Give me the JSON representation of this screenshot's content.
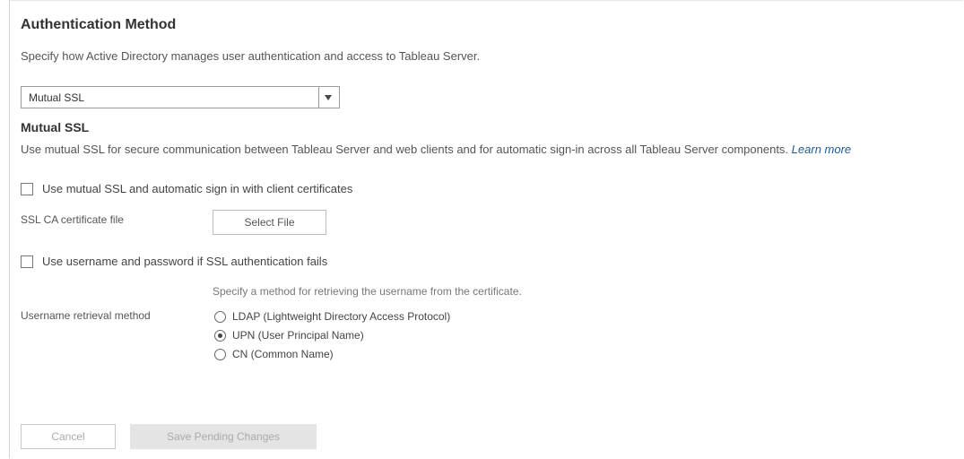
{
  "section": {
    "title": "Authentication Method",
    "description": "Specify how Active Directory manages user authentication and access to Tableau Server."
  },
  "method_select": {
    "value": "Mutual SSL",
    "icon": "chevron-down-icon"
  },
  "mutual_ssl": {
    "title": "Mutual SSL",
    "description": "Use mutual SSL for secure communication between Tableau Server and web clients and for automatic sign-in across all Tableau Server components.",
    "learn_more": "Learn more",
    "enable_checkbox_label": "Use mutual SSL and automatic sign in with client certificates",
    "enable_checked": false,
    "ca_file_label": "SSL CA certificate file",
    "select_file_button": "Select File",
    "fallback_checkbox_label": "Use username and password if SSL authentication fails",
    "fallback_checked": false,
    "retrieval_hint": "Specify a method for retrieving the username from the certificate.",
    "retrieval_label": "Username retrieval method",
    "retrieval_options": [
      {
        "label": "LDAP (Lightweight Directory Access Protocol)",
        "selected": false
      },
      {
        "label": "UPN (User Principal Name)",
        "selected": true
      },
      {
        "label": "CN (Common Name)",
        "selected": false
      }
    ]
  },
  "footer": {
    "cancel_label": "Cancel",
    "save_label": "Save Pending Changes"
  },
  "colors": {
    "link": "#1f5a96",
    "disabled_button_bg": "#e4e4e4",
    "disabled_text": "#aaaaaa"
  }
}
